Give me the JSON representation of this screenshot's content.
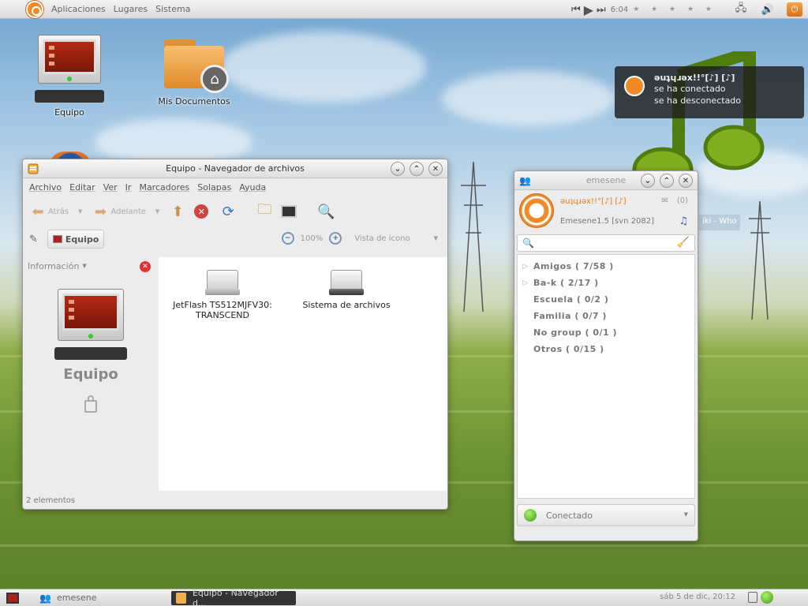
{
  "top_panel": {
    "menus": [
      "Aplicaciones",
      "Lugares",
      "Sistema"
    ],
    "time": "6:04",
    "stars": "★ ★ ★ ★ ★"
  },
  "desktop": {
    "icons": [
      {
        "label": "Equipo"
      },
      {
        "label": "Mis Documentos"
      }
    ]
  },
  "notification": {
    "title": "ǝuʇɥɹǝx!!°[♪] [♪]",
    "lines": [
      "se ha conectado",
      "se ha desconectado"
    ]
  },
  "wallpaper_overlay_text": "iki - Who",
  "file_manager": {
    "title": "Equipo - Navegador de archivos",
    "menus": [
      "Archivo",
      "Editar",
      "Ver",
      "Ir",
      "Marcadores",
      "Solapas",
      "Ayuda"
    ],
    "toolbar": {
      "back": "Atrás",
      "forward": "Adelante"
    },
    "location": "Equipo",
    "zoom": "100%",
    "view_mode": "Vista de icono",
    "sidebar": {
      "header": "Información",
      "title": "Equipo"
    },
    "files": [
      {
        "name": "JetFlash TS512MJFV30: TRANSCEND"
      },
      {
        "name": "Sistema de archivos"
      }
    ],
    "status": "2 elementos"
  },
  "emesene": {
    "title": "emesene",
    "nick": "ǝuʇɥɹǝx!!°[♪] [♪]",
    "psm": "Emesene1.5 [svn 2082]",
    "mail_count": "(0)",
    "groups": [
      {
        "name": "Amigos ( 7/58 )",
        "expandable": true
      },
      {
        "name": "Ba-k ( 2/17 )",
        "expandable": true
      },
      {
        "name": "Escuela ( 0/2 )",
        "expandable": false
      },
      {
        "name": "Familia ( 0/7 )",
        "expandable": false
      },
      {
        "name": "No group ( 0/1 )",
        "expandable": false
      },
      {
        "name": "Otros ( 0/15 )",
        "expandable": false
      }
    ],
    "status": "Conectado"
  },
  "bottom_panel": {
    "tasks": [
      "emesene",
      "Equipo - Navegador d..."
    ],
    "datetime": "sáb  5 de dic, 20:12"
  },
  "colors": {
    "accent_orange": "#f08a24",
    "panel_bg": "#e6e6e6",
    "online_green": "#3a9a1a"
  }
}
